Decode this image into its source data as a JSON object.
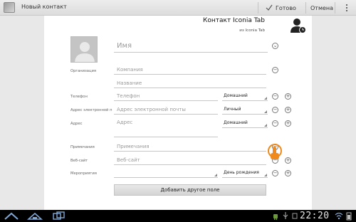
{
  "action_bar": {
    "title": "Новый контакт",
    "done_label": "Готово",
    "cancel_label": "Отмена"
  },
  "account": {
    "name": "Контакт Iconia Tab",
    "sub": "из Iconia Tab"
  },
  "fields": {
    "name": {
      "placeholder": "Имя"
    },
    "organization": {
      "label": "Организация",
      "company_placeholder": "Компания",
      "title_placeholder": "Название"
    },
    "phone": {
      "label": "Телефон",
      "placeholder": "Телефон",
      "type": "Домашний"
    },
    "email": {
      "label": "Адрес электронной п",
      "placeholder": "Адрес электронной почты",
      "type": "Личный"
    },
    "address": {
      "label": "Адрес",
      "placeholder": "Адрес",
      "type": "Домашний"
    },
    "notes": {
      "label": "Примечания",
      "placeholder": "Примечания"
    },
    "website": {
      "label": "Веб-сайт",
      "placeholder": "Веб-сайт"
    },
    "event": {
      "label": "Мероприятия",
      "type": "День рождения"
    }
  },
  "add_field_label": "Добавить другое поле",
  "status_bar": {
    "time": "22:20"
  },
  "icons": {
    "app": "contact-icon",
    "done": "check-icon",
    "menu": "overflow-menu-icon",
    "account": "account-avatar-icon",
    "photo": "contact-photo-placeholder-icon",
    "remove": "remove-circle-icon",
    "add": "add-circle-icon",
    "expand": "chevron-down-icon",
    "back": "back-icon",
    "home": "home-icon",
    "recents": "recent-apps-icon",
    "overlay": "hand-touch-icon"
  },
  "colors": {
    "accent_orange": "#f08a1c",
    "nav_bg": "#000000",
    "sheet_bg": "#ffffff"
  }
}
